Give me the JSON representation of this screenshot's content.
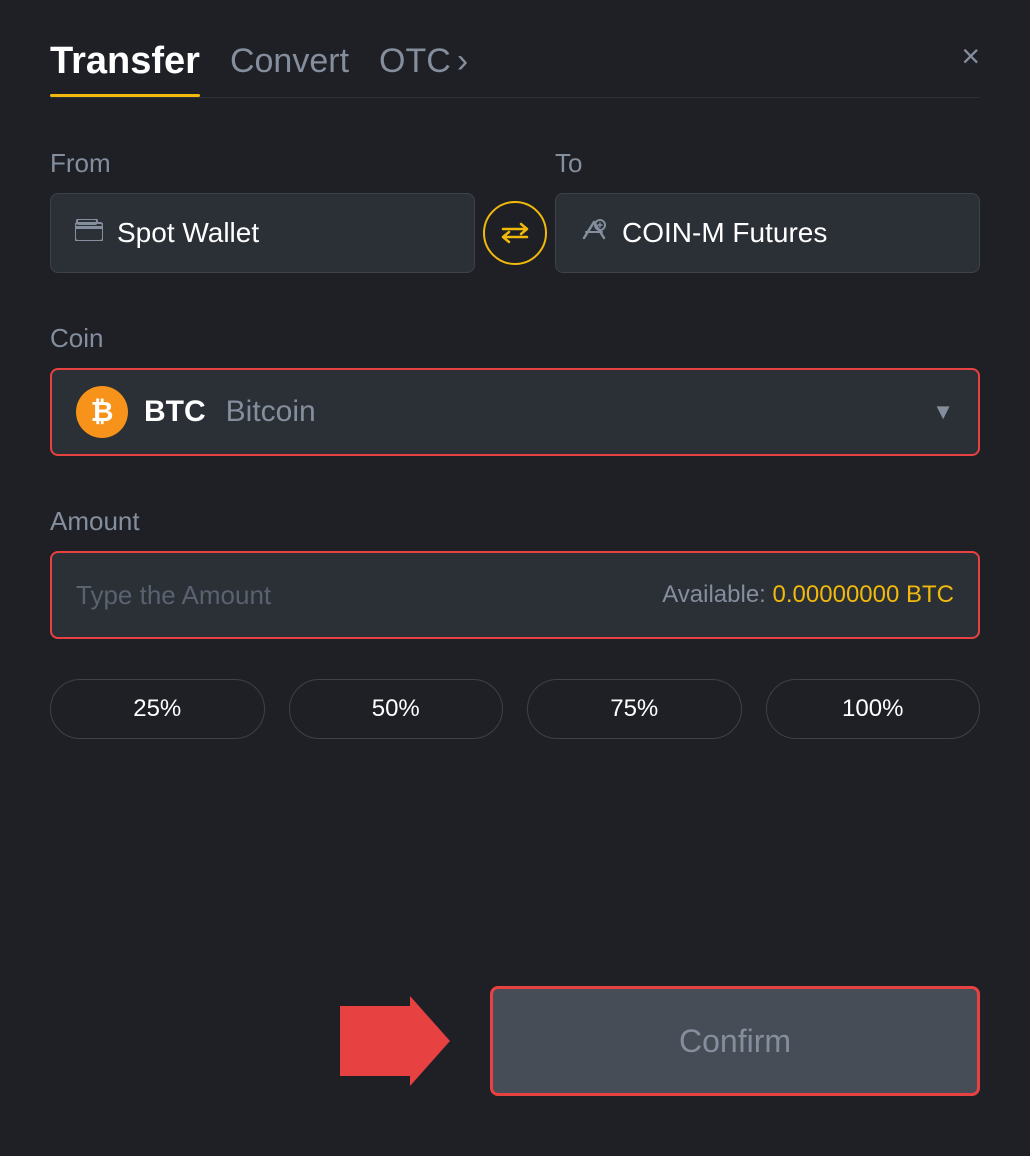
{
  "header": {
    "tab_transfer": "Transfer",
    "tab_convert": "Convert",
    "tab_otc": "OTC",
    "tab_otc_chevron": "›",
    "close_label": "×"
  },
  "from_section": {
    "label": "From",
    "wallet_name": "Spot Wallet"
  },
  "to_section": {
    "label": "To",
    "wallet_name": "COIN-M Futures"
  },
  "coin_section": {
    "label": "Coin",
    "coin_code": "BTC",
    "coin_name": "Bitcoin"
  },
  "amount_section": {
    "label": "Amount",
    "placeholder": "Type the Amount",
    "available_label": "Available:",
    "available_value": "0.00000000 BTC"
  },
  "pct_buttons": [
    "25%",
    "50%",
    "75%",
    "100%"
  ],
  "confirm_button": "Confirm"
}
